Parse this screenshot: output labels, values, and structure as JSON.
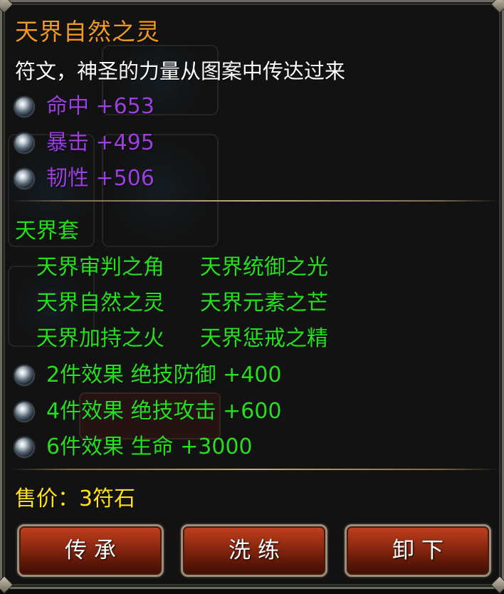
{
  "item": {
    "name": "天界自然之灵",
    "description": "符文，神圣的力量从图案中传达过来"
  },
  "stats": [
    {
      "label": "命中 +653",
      "icon": "rune-orb-icon"
    },
    {
      "label": "暴击 +495",
      "icon": "rune-orb-icon"
    },
    {
      "label": "韧性 +506",
      "icon": "rune-orb-icon"
    }
  ],
  "set": {
    "name": "天界套",
    "pieces": [
      [
        "天界审判之角",
        "天界统御之光"
      ],
      [
        "天界自然之灵",
        "天界元素之芒"
      ],
      [
        "天界加持之火",
        "天界惩戒之精"
      ]
    ],
    "bonuses": [
      {
        "label": "2件效果  绝技防御 +400",
        "icon": "rune-orb-icon"
      },
      {
        "label": "4件效果  绝技攻击 +600",
        "icon": "rune-orb-icon"
      },
      {
        "label": "6件效果  生命 +3000",
        "icon": "rune-orb-icon"
      }
    ]
  },
  "price": "售价：3符石",
  "buttons": {
    "inherit": "传承",
    "refine": "洗练",
    "unequip": "卸下"
  },
  "colors": {
    "title": "#f39a1e",
    "stat": "#9b3fe0",
    "set": "#25e11c",
    "price": "#ffe21a",
    "button": "#8f2a12"
  }
}
